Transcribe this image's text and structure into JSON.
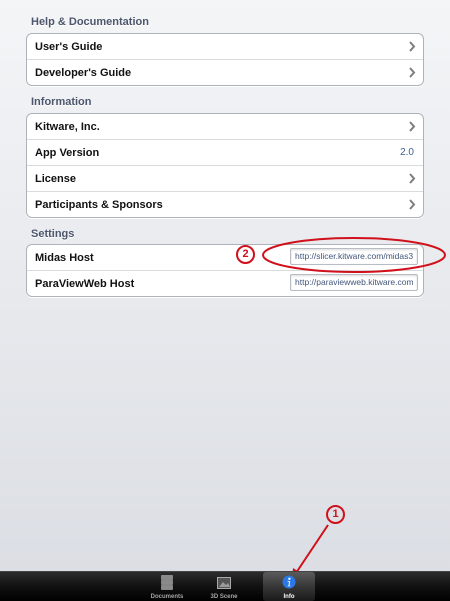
{
  "sections": {
    "help": {
      "header": "Help & Documentation",
      "items": [
        {
          "label": "User's Guide"
        },
        {
          "label": "Developer's Guide"
        }
      ]
    },
    "information": {
      "header": "Information",
      "items": [
        {
          "label": "Kitware, Inc."
        },
        {
          "label": "App Version",
          "value": "2.0"
        },
        {
          "label": "License"
        },
        {
          "label": "Participants & Sponsors"
        }
      ]
    },
    "settings": {
      "header": "Settings",
      "items": [
        {
          "label": "Midas Host",
          "value": "http://slicer.kitware.com/midas3"
        },
        {
          "label": "ParaViewWeb Host",
          "value": "http://paraviewweb.kitware.com"
        }
      ]
    }
  },
  "annotations": {
    "one": "1",
    "two": "2"
  },
  "tabbar": {
    "tabs": [
      {
        "label": "Documents",
        "icon": "documents-icon"
      },
      {
        "label": "3D Scene",
        "icon": "scene-icon"
      },
      {
        "label": "Info",
        "icon": "info-icon",
        "active": true
      }
    ]
  },
  "colors": {
    "annotation": "#d0101b",
    "value_text": "#3e5f8c",
    "tabbar": "#000000"
  }
}
